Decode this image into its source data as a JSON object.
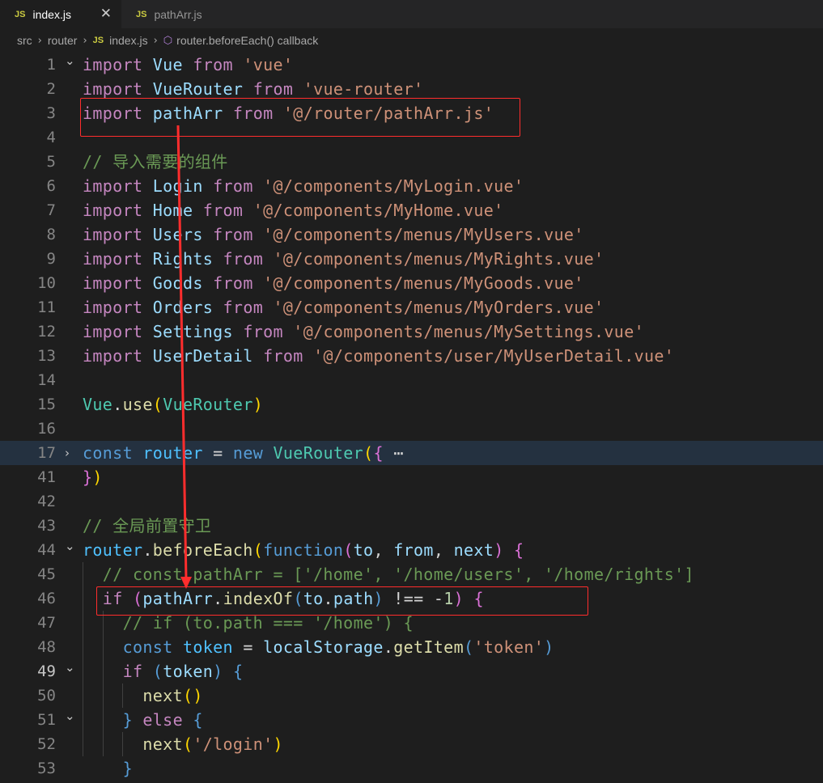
{
  "tabs": [
    {
      "badge": "JS",
      "label": "index.js",
      "active": true,
      "close": "✕"
    },
    {
      "badge": "JS",
      "label": "pathArr.js",
      "active": false
    }
  ],
  "breadcrumb": [
    "src",
    "router",
    "index.js",
    "router.beforeEach() callback"
  ],
  "icons": {
    "js-file": "JS",
    "symbol-method": "cube",
    "fold-open": "chevron-down",
    "fold-closed": "chevron-right",
    "close": "x"
  },
  "lines": [
    {
      "n": "1",
      "fold": "open",
      "tokens": [
        [
          "kw",
          "import"
        ],
        [
          "pn",
          " "
        ],
        [
          "vr",
          "Vue"
        ],
        [
          "pn",
          " "
        ],
        [
          "kw",
          "from"
        ],
        [
          "pn",
          " "
        ],
        [
          "st",
          "'vue'"
        ]
      ]
    },
    {
      "n": "2",
      "tokens": [
        [
          "kw",
          "import"
        ],
        [
          "pn",
          " "
        ],
        [
          "vr",
          "VueRouter"
        ],
        [
          "pn",
          " "
        ],
        [
          "kw",
          "from"
        ],
        [
          "pn",
          " "
        ],
        [
          "st",
          "'vue-router'"
        ]
      ]
    },
    {
      "n": "3",
      "tokens": [
        [
          "kw",
          "import"
        ],
        [
          "pn",
          " "
        ],
        [
          "vr",
          "pathArr"
        ],
        [
          "pn",
          " "
        ],
        [
          "kw",
          "from"
        ],
        [
          "pn",
          " "
        ],
        [
          "st",
          "'@/router/pathArr.js'"
        ]
      ]
    },
    {
      "n": "4",
      "tokens": []
    },
    {
      "n": "5",
      "tokens": [
        [
          "cm",
          "// 导入需要的组件"
        ]
      ]
    },
    {
      "n": "6",
      "tokens": [
        [
          "kw",
          "import"
        ],
        [
          "pn",
          " "
        ],
        [
          "vr",
          "Login"
        ],
        [
          "pn",
          " "
        ],
        [
          "kw",
          "from"
        ],
        [
          "pn",
          " "
        ],
        [
          "st",
          "'@/components/MyLogin.vue'"
        ]
      ]
    },
    {
      "n": "7",
      "tokens": [
        [
          "kw",
          "import"
        ],
        [
          "pn",
          " "
        ],
        [
          "vr",
          "Home"
        ],
        [
          "pn",
          " "
        ],
        [
          "kw",
          "from"
        ],
        [
          "pn",
          " "
        ],
        [
          "st",
          "'@/components/MyHome.vue'"
        ]
      ]
    },
    {
      "n": "8",
      "tokens": [
        [
          "kw",
          "import"
        ],
        [
          "pn",
          " "
        ],
        [
          "vr",
          "Users"
        ],
        [
          "pn",
          " "
        ],
        [
          "kw",
          "from"
        ],
        [
          "pn",
          " "
        ],
        [
          "st",
          "'@/components/menus/MyUsers.vue'"
        ]
      ]
    },
    {
      "n": "9",
      "tokens": [
        [
          "kw",
          "import"
        ],
        [
          "pn",
          " "
        ],
        [
          "vr",
          "Rights"
        ],
        [
          "pn",
          " "
        ],
        [
          "kw",
          "from"
        ],
        [
          "pn",
          " "
        ],
        [
          "st",
          "'@/components/menus/MyRights.vue'"
        ]
      ]
    },
    {
      "n": "10",
      "tokens": [
        [
          "kw",
          "import"
        ],
        [
          "pn",
          " "
        ],
        [
          "vr",
          "Goods"
        ],
        [
          "pn",
          " "
        ],
        [
          "kw",
          "from"
        ],
        [
          "pn",
          " "
        ],
        [
          "st",
          "'@/components/menus/MyGoods.vue'"
        ]
      ]
    },
    {
      "n": "11",
      "tokens": [
        [
          "kw",
          "import"
        ],
        [
          "pn",
          " "
        ],
        [
          "vr",
          "Orders"
        ],
        [
          "pn",
          " "
        ],
        [
          "kw",
          "from"
        ],
        [
          "pn",
          " "
        ],
        [
          "st",
          "'@/components/menus/MyOrders.vue'"
        ]
      ]
    },
    {
      "n": "12",
      "tokens": [
        [
          "kw",
          "import"
        ],
        [
          "pn",
          " "
        ],
        [
          "vr",
          "Settings"
        ],
        [
          "pn",
          " "
        ],
        [
          "kw",
          "from"
        ],
        [
          "pn",
          " "
        ],
        [
          "st",
          "'@/components/menus/MySettings.vue'"
        ]
      ]
    },
    {
      "n": "13",
      "tokens": [
        [
          "kw",
          "import"
        ],
        [
          "pn",
          " "
        ],
        [
          "vr",
          "UserDetail"
        ],
        [
          "pn",
          " "
        ],
        [
          "kw",
          "from"
        ],
        [
          "pn",
          " "
        ],
        [
          "st",
          "'@/components/user/MyUserDetail.vue'"
        ]
      ]
    },
    {
      "n": "14",
      "tokens": []
    },
    {
      "n": "15",
      "tokens": [
        [
          "ty",
          "Vue"
        ],
        [
          "pn",
          "."
        ],
        [
          "fn",
          "use"
        ],
        [
          "yb",
          "("
        ],
        [
          "ty",
          "VueRouter"
        ],
        [
          "yb",
          ")"
        ]
      ]
    },
    {
      "n": "16",
      "tokens": []
    },
    {
      "n": "17",
      "fold": "closed",
      "hl": true,
      "tokens": [
        [
          "bl",
          "const"
        ],
        [
          "pn",
          " "
        ],
        [
          "cn",
          "router"
        ],
        [
          "pn",
          " = "
        ],
        [
          "bl",
          "new"
        ],
        [
          "pn",
          " "
        ],
        [
          "ty",
          "VueRouter"
        ],
        [
          "yb",
          "("
        ],
        [
          "pu",
          "{"
        ],
        [
          "pn",
          " ⋯"
        ]
      ]
    },
    {
      "n": "41",
      "tokens": [
        [
          "pu",
          "}"
        ],
        [
          "yb",
          ")"
        ]
      ]
    },
    {
      "n": "42",
      "tokens": []
    },
    {
      "n": "43",
      "tokens": [
        [
          "cm",
          "// 全局前置守卫"
        ]
      ]
    },
    {
      "n": "44",
      "fold": "open",
      "tokens": [
        [
          "cn",
          "router"
        ],
        [
          "pn",
          "."
        ],
        [
          "fn",
          "beforeEach"
        ],
        [
          "yb",
          "("
        ],
        [
          "bl",
          "function"
        ],
        [
          "pu",
          "("
        ],
        [
          "vr",
          "to"
        ],
        [
          "pn",
          ", "
        ],
        [
          "vr",
          "from"
        ],
        [
          "pn",
          ", "
        ],
        [
          "vr",
          "next"
        ],
        [
          "pu",
          ")"
        ],
        [
          "pn",
          " "
        ],
        [
          "pu",
          "{"
        ]
      ]
    },
    {
      "n": "45",
      "tokens": [
        [
          "pn",
          "  "
        ],
        [
          "cm",
          "// const pathArr = ['/home', '/home/users', '/home/rights']"
        ]
      ]
    },
    {
      "n": "46",
      "tokens": [
        [
          "pn",
          "  "
        ],
        [
          "kw",
          "if"
        ],
        [
          "pn",
          " "
        ],
        [
          "pu",
          "("
        ],
        [
          "vr",
          "pathArr"
        ],
        [
          "pn",
          "."
        ],
        [
          "fn",
          "indexOf"
        ],
        [
          "bl",
          "("
        ],
        [
          "vr",
          "to"
        ],
        [
          "pn",
          "."
        ],
        [
          "vr",
          "path"
        ],
        [
          "bl",
          ")"
        ],
        [
          "pn",
          " !== -"
        ],
        [
          "nm",
          "1"
        ],
        [
          "pu",
          ")"
        ],
        [
          "pn",
          " "
        ],
        [
          "pu",
          "{"
        ]
      ]
    },
    {
      "n": "47",
      "tokens": [
        [
          "pn",
          "    "
        ],
        [
          "cm",
          "// if (to.path === '/home') {"
        ]
      ]
    },
    {
      "n": "48",
      "tokens": [
        [
          "pn",
          "    "
        ],
        [
          "bl",
          "const"
        ],
        [
          "pn",
          " "
        ],
        [
          "cn",
          "token"
        ],
        [
          "pn",
          " = "
        ],
        [
          "vr",
          "localStorage"
        ],
        [
          "pn",
          "."
        ],
        [
          "fn",
          "getItem"
        ],
        [
          "bl",
          "("
        ],
        [
          "st",
          "'token'"
        ],
        [
          "bl",
          ")"
        ]
      ]
    },
    {
      "n": "49",
      "fold": "open",
      "cur": true,
      "tokens": [
        [
          "pn",
          "    "
        ],
        [
          "kw",
          "if"
        ],
        [
          "pn",
          " "
        ],
        [
          "bl",
          "("
        ],
        [
          "vr",
          "token"
        ],
        [
          "bl",
          ")"
        ],
        [
          "pn",
          " "
        ],
        [
          "bl",
          "{"
        ]
      ]
    },
    {
      "n": "50",
      "tokens": [
        [
          "pn",
          "      "
        ],
        [
          "fn",
          "next"
        ],
        [
          "yb",
          "()"
        ]
      ]
    },
    {
      "n": "51",
      "fold": "open",
      "tokens": [
        [
          "pn",
          "    "
        ],
        [
          "bl",
          "}"
        ],
        [
          "pn",
          " "
        ],
        [
          "kw",
          "else"
        ],
        [
          "pn",
          " "
        ],
        [
          "bl",
          "{"
        ]
      ]
    },
    {
      "n": "52",
      "tokens": [
        [
          "pn",
          "      "
        ],
        [
          "fn",
          "next"
        ],
        [
          "yb",
          "("
        ],
        [
          "st",
          "'/login'"
        ],
        [
          "yb",
          ")"
        ]
      ]
    },
    {
      "n": "53",
      "tokens": [
        [
          "pn",
          "    "
        ],
        [
          "bl",
          "}"
        ]
      ]
    }
  ],
  "annotation_color": "#ff2d2d"
}
